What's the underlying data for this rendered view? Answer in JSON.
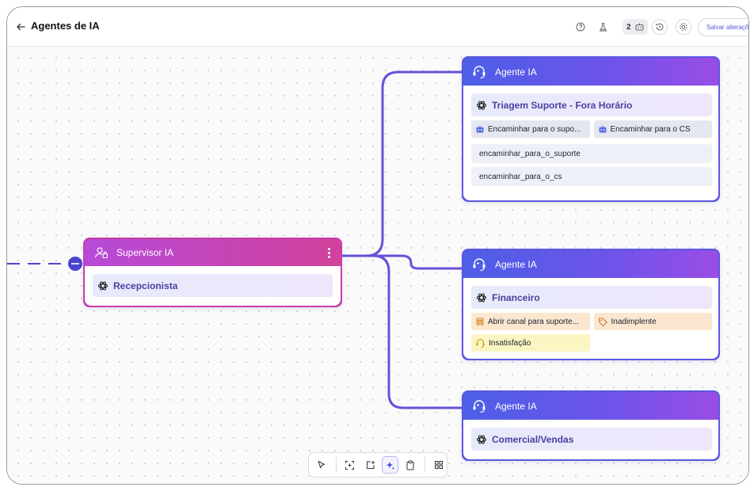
{
  "header": {
    "title": "Agentes de IA",
    "badge_count": "2",
    "save_label": "Salvar alterações"
  },
  "supervisor": {
    "title": "Supervisor IA",
    "prompt": "Recepcionista",
    "head_gradient": [
      "#b64ad8",
      "#d2419b"
    ]
  },
  "agents": [
    {
      "title": "Agente IA",
      "prompt": "Triagem Suporte - Fora Horário",
      "handoffs": [
        "Encaminhar para o supo...",
        "Encaminhar para o CS"
      ],
      "functions": [
        "encaminhar_para_o_suporte",
        "encaminhar_para_o_cs"
      ]
    },
    {
      "title": "Agente IA",
      "prompt": "Financeiro",
      "actions": [
        {
          "label": "Abrir canal para suporte...",
          "color": "#fbe7d0",
          "icon": "stack-icon"
        },
        {
          "label": "Inadimplente",
          "color": "#fbe7d0",
          "icon": "tag-icon"
        },
        {
          "label": "Insatisfação",
          "color": "#fbf5c3",
          "icon": "headset-icon"
        }
      ]
    },
    {
      "title": "Agente IA",
      "prompt": "Comercial/Vendas"
    }
  ],
  "toolbar": {
    "tools": [
      "pointer-icon",
      "fit-view-icon",
      "add-node-icon",
      "ai-sparkle-icon",
      "clipboard-icon",
      "grid-icon"
    ],
    "active": "ai-sparkle-icon"
  },
  "colors": {
    "agent_head": [
      "#4d5fe6",
      "#9a4de6"
    ],
    "edge": "#6a4fd8",
    "accent": "#5c57e2"
  }
}
